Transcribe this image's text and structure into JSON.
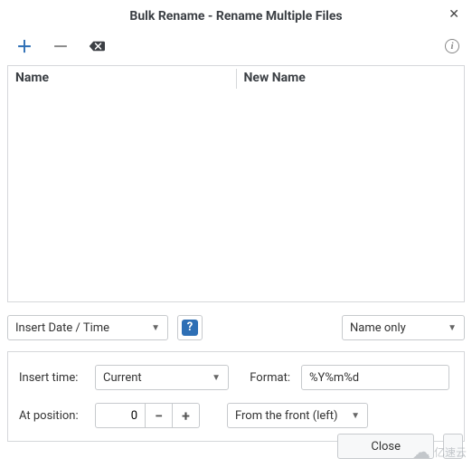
{
  "window": {
    "title": "Bulk Rename - Rename Multiple Files"
  },
  "list": {
    "columns": {
      "name": "Name",
      "new_name": "New Name"
    }
  },
  "mode_combo": {
    "value": "Insert Date / Time"
  },
  "scope_combo": {
    "value": "Name only"
  },
  "options": {
    "insert_time_label": "Insert time:",
    "insert_time_value": "Current",
    "format_label": "Format:",
    "format_value": "%Y%m%d",
    "position_label": "At position:",
    "position_value": "0",
    "direction_value": "From the front (left)"
  },
  "footer": {
    "close": "Close"
  },
  "watermark": "亿速云"
}
